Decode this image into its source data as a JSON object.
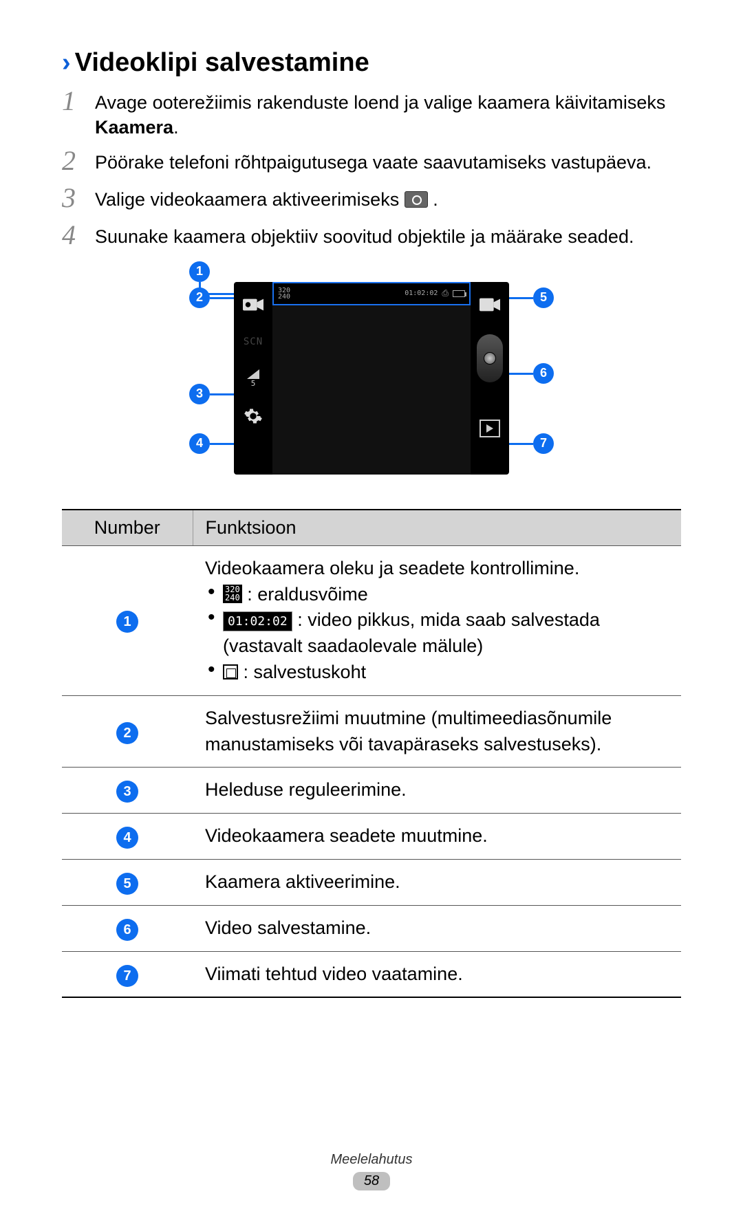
{
  "heading": "Videoklipi salvestamine",
  "steps": {
    "s1": {
      "num": "1",
      "text_a": "Avage ooterežiimis rakenduste loend ja valige kaamera käivitamiseks ",
      "bold": "Kaamera",
      "text_b": "."
    },
    "s2": {
      "num": "2",
      "text": "Pöörake telefoni rõhtpaigutusega vaate saavutamiseks vastupäeva."
    },
    "s3": {
      "num": "3",
      "text_a": "Valige videokaamera aktiveerimiseks ",
      "text_b": "."
    },
    "s4": {
      "num": "4",
      "text": "Suunake kaamera objektiiv soovitud objektile ja määrake seaded."
    }
  },
  "diagram": {
    "res_top": "320",
    "res_bot": "240",
    "time": "01:02:02",
    "scn": "SCN",
    "exp": "5",
    "callouts": {
      "c1": "1",
      "c2": "2",
      "c3": "3",
      "c4": "4",
      "c5": "5",
      "c6": "6",
      "c7": "7"
    }
  },
  "table": {
    "h1": "Number",
    "h2": "Funktsioon",
    "r1": {
      "lead": "Videokaamera oleku ja seadete kontrollimine.",
      "li1_res_top": "320",
      "li1_res_bot": "240",
      "li1_text": " : eraldusvõime",
      "li2_time": "01:02:02",
      "li2_text": " : video pikkus, mida saab salvestada (vastavalt saadaolevale mälule)",
      "li3_text": " : salvestuskoht"
    },
    "r2": "Salvestusrežiimi muutmine (multimeediasõnumile manustamiseks või tavapäraseks salvestuseks).",
    "r3": "Heleduse reguleerimine.",
    "r4": "Videokaamera seadete muutmine.",
    "r5": "Kaamera aktiveerimine.",
    "r6": "Video salvestamine.",
    "r7": "Viimati tehtud video vaatamine."
  },
  "footer": {
    "section": "Meelelahutus",
    "page": "58"
  }
}
